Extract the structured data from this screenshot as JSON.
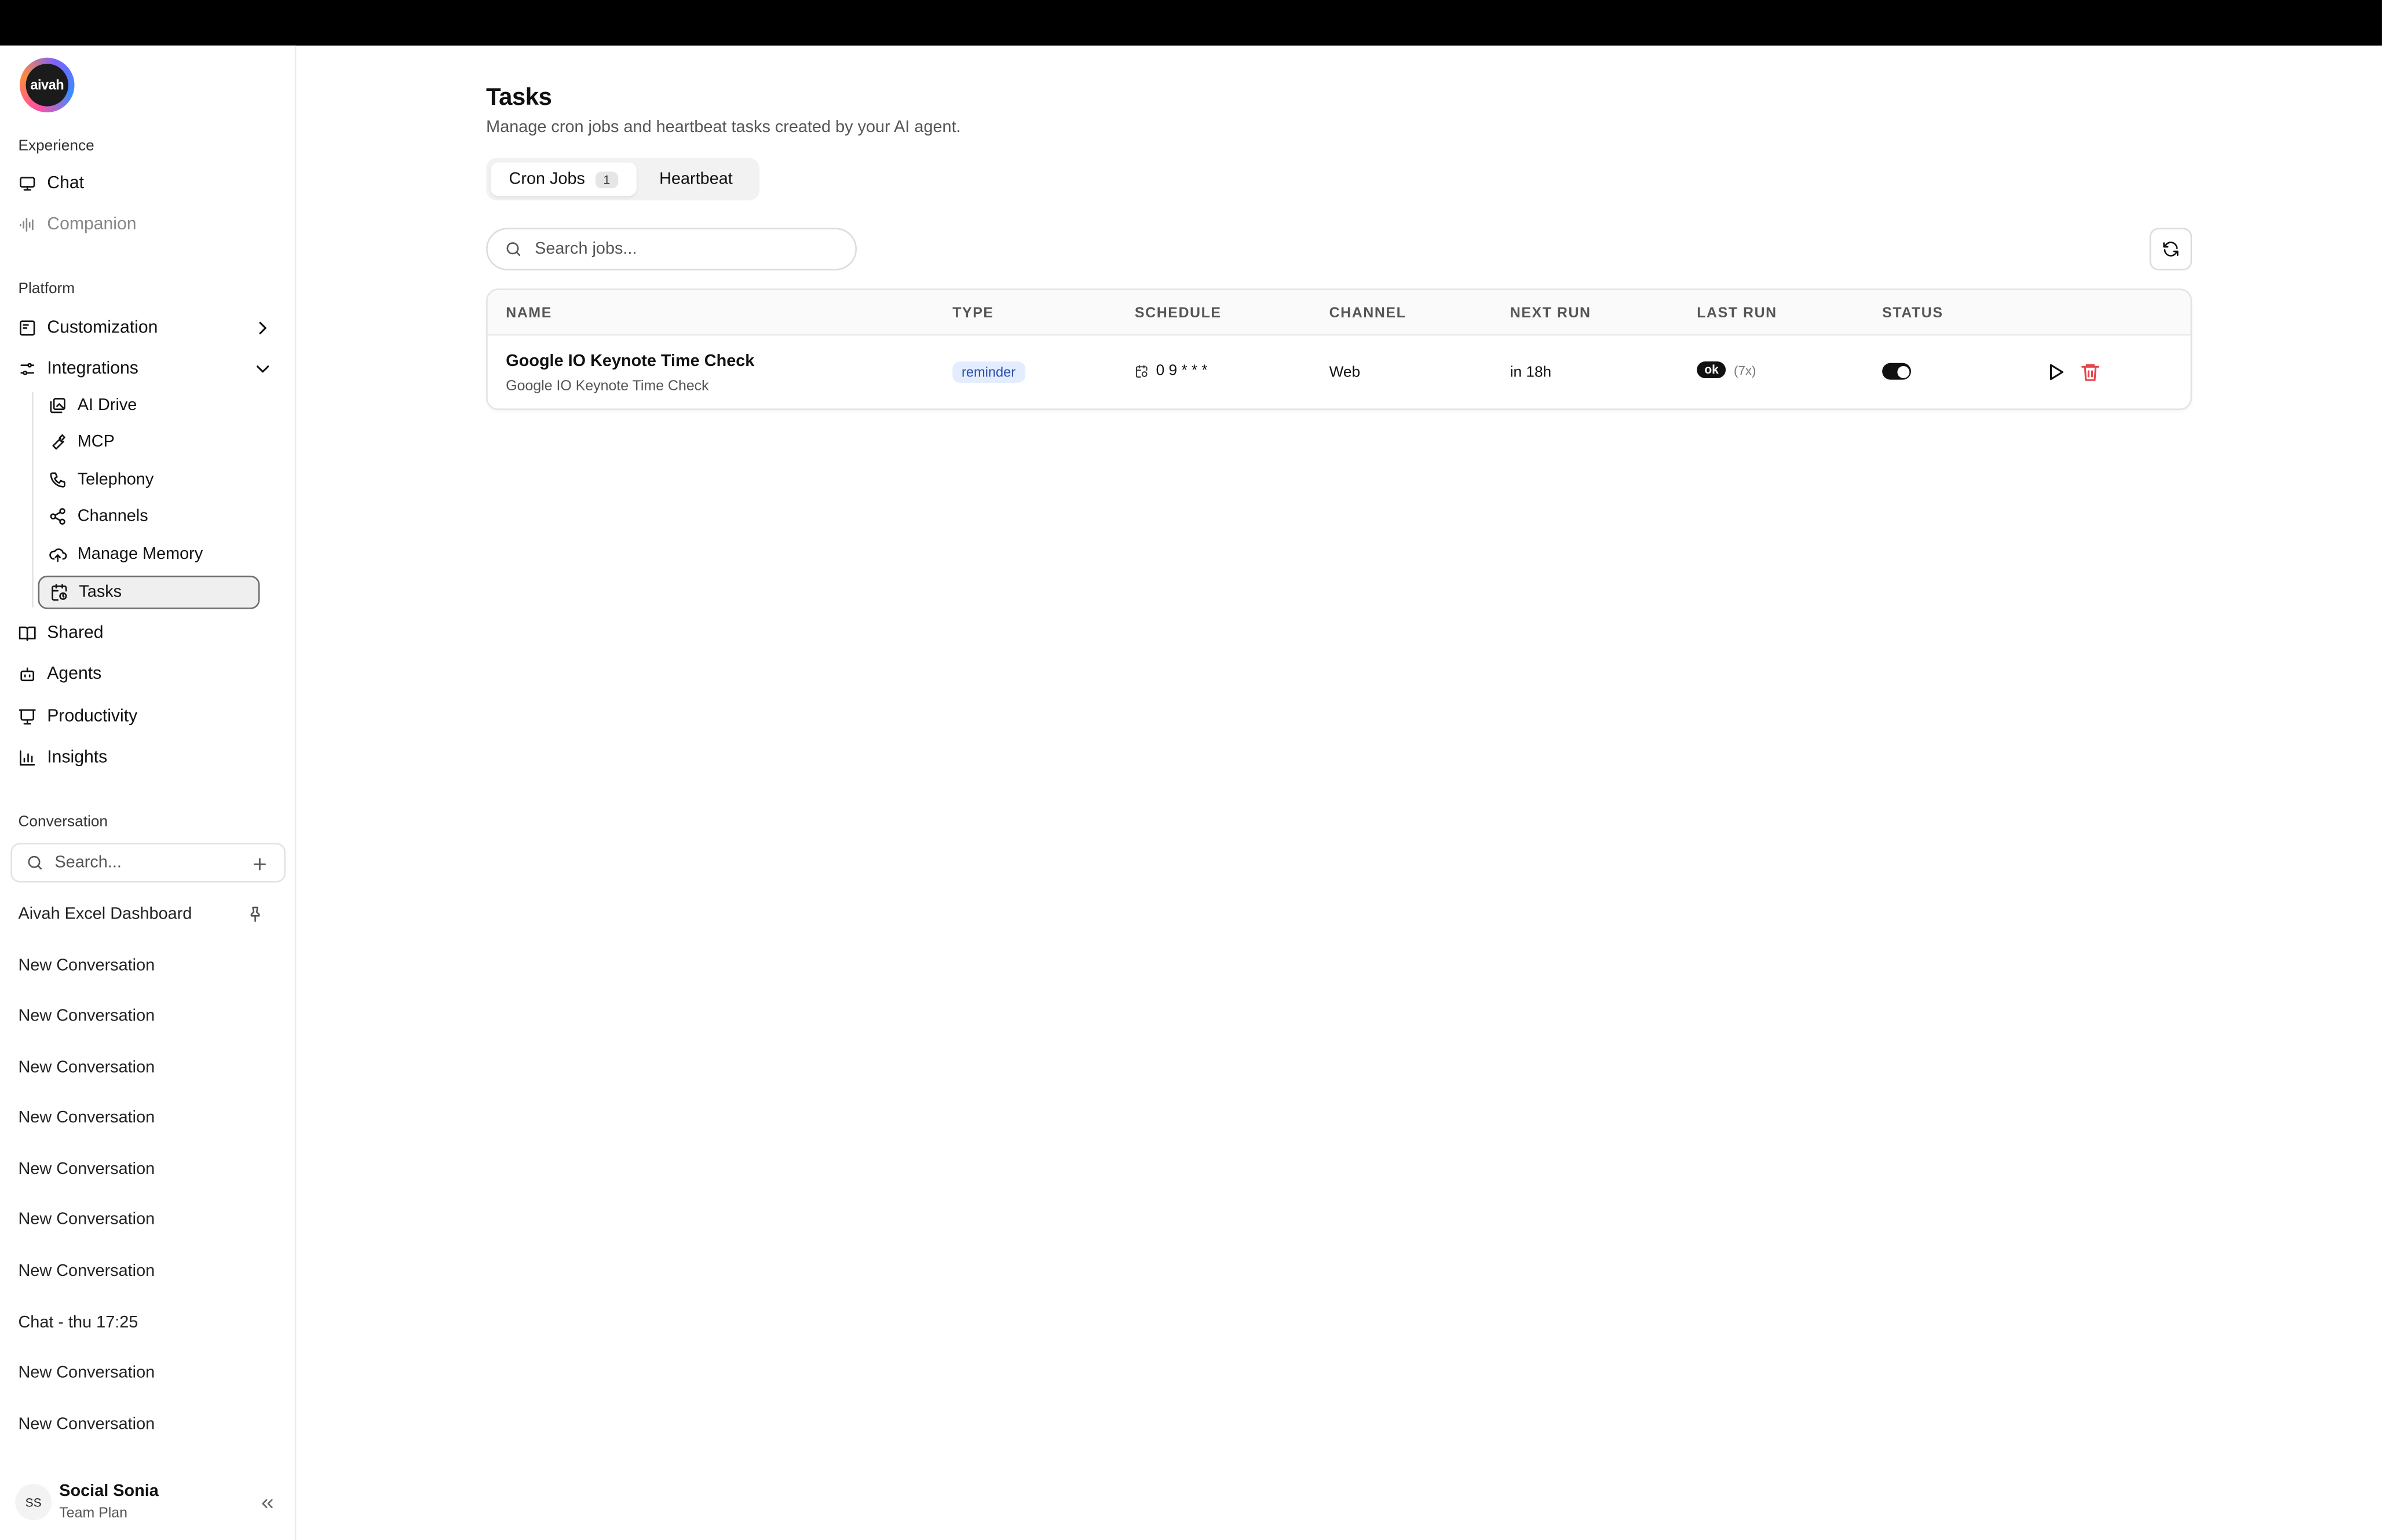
{
  "app": {
    "logo_text": "aivah"
  },
  "sidebar": {
    "experience_label": "Experience",
    "experience_items": [
      {
        "label": "Chat",
        "icon": "monitor-icon"
      },
      {
        "label": "Companion",
        "icon": "audio-wave-icon"
      }
    ],
    "platform_label": "Platform",
    "platform_items": [
      {
        "label": "Customization",
        "icon": "layout-icon"
      },
      {
        "label": "Integrations",
        "icon": "sliders-icon"
      }
    ],
    "integrations_sub": [
      {
        "label": "AI Drive",
        "icon": "images-icon"
      },
      {
        "label": "MCP",
        "icon": "wrench-icon"
      },
      {
        "label": "Telephony",
        "icon": "phone-icon"
      },
      {
        "label": "Channels",
        "icon": "share-icon"
      },
      {
        "label": "Manage Memory",
        "icon": "cloud-upload-icon"
      },
      {
        "label": "Tasks",
        "icon": "calendar-clock-icon"
      }
    ],
    "more_items": [
      {
        "label": "Shared",
        "icon": "book-icon"
      },
      {
        "label": "Agents",
        "icon": "bot-icon"
      },
      {
        "label": "Productivity",
        "icon": "presentation-icon"
      },
      {
        "label": "Insights",
        "icon": "bar-chart-icon"
      }
    ],
    "conversation_label": "Conversation",
    "conversation_search_placeholder": "Search...",
    "conversations": [
      "Aivah Excel Dashboard",
      "New Conversation",
      "New Conversation",
      "New Conversation",
      "New Conversation",
      "New Conversation",
      "New Conversation",
      "New Conversation",
      "Chat - thu 17:25",
      "New Conversation",
      "New Conversation"
    ],
    "user": {
      "initials": "SS",
      "name": "Social Sonia",
      "plan": "Team Plan"
    }
  },
  "main": {
    "title": "Tasks",
    "subtitle": "Manage cron jobs and heartbeat tasks created by your AI agent.",
    "tabs": [
      {
        "label": "Cron Jobs",
        "count": "1"
      },
      {
        "label": "Heartbeat"
      }
    ],
    "search_placeholder": "Search jobs...",
    "table": {
      "headers": [
        "NAME",
        "TYPE",
        "SCHEDULE",
        "CHANNEL",
        "NEXT RUN",
        "LAST RUN",
        "STATUS"
      ],
      "rows": [
        {
          "name": "Google IO Keynote Time Check",
          "description": "Google IO Keynote Time Check",
          "type": "reminder",
          "schedule": "0 9 * * *",
          "channel": "Web",
          "next_run": "in 18h",
          "last_run_status": "ok",
          "last_run_count": "(7x)",
          "enabled": true
        }
      ]
    }
  },
  "colors": {
    "accent": "#111111",
    "badge_bg": "#e3edff",
    "badge_text": "#2c4fa8",
    "danger": "#e5484d"
  }
}
